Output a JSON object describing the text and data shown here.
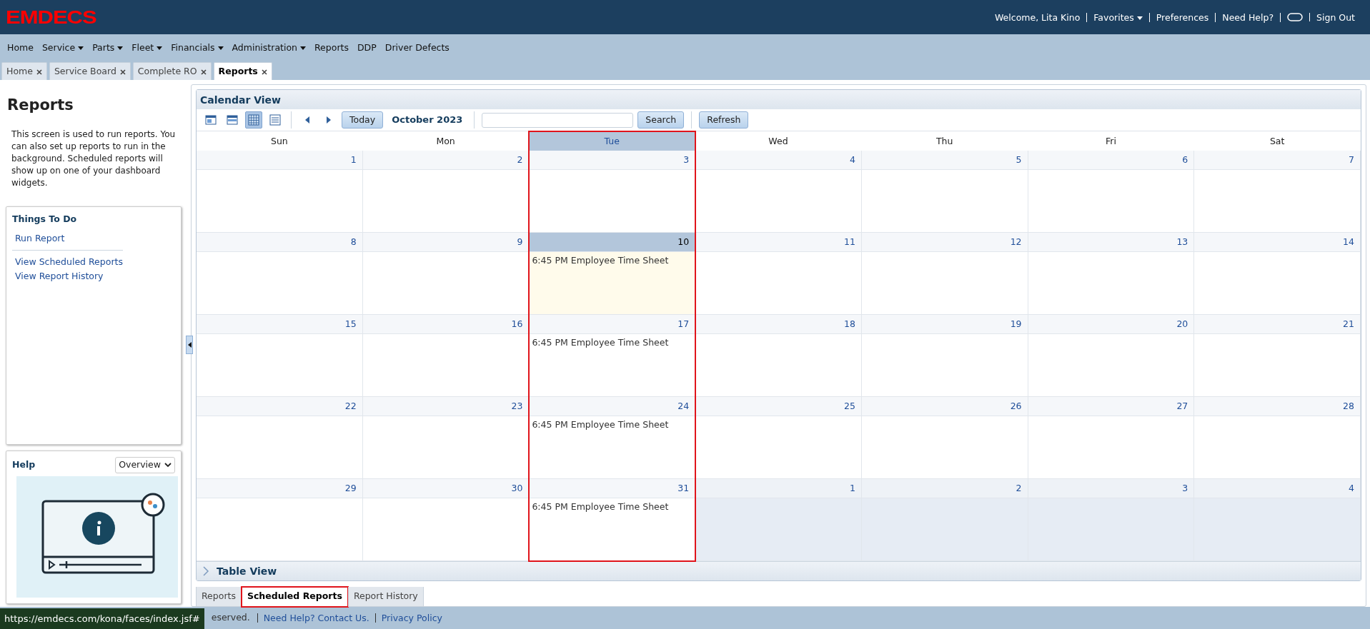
{
  "app": {
    "logo": "EMDECS"
  },
  "header": {
    "welcome": "Welcome, Lita Kino",
    "links": [
      {
        "kind": "dropdown",
        "label": "Favorites"
      },
      {
        "kind": "link",
        "label": "Preferences"
      },
      {
        "kind": "link",
        "label": "Need Help?"
      },
      {
        "kind": "chat"
      },
      {
        "kind": "link",
        "label": "Sign Out"
      }
    ]
  },
  "menu": [
    {
      "label": "Home",
      "dropdown": false
    },
    {
      "label": "Service",
      "dropdown": true
    },
    {
      "label": "Parts",
      "dropdown": true
    },
    {
      "label": "Fleet",
      "dropdown": true
    },
    {
      "label": "Financials",
      "dropdown": true
    },
    {
      "label": "Administration",
      "dropdown": true
    },
    {
      "label": "Reports",
      "dropdown": false
    },
    {
      "label": "DDP",
      "dropdown": false
    },
    {
      "label": "Driver Defects",
      "dropdown": false
    }
  ],
  "tabs": [
    {
      "label": "Home",
      "selected": false
    },
    {
      "label": "Service Board",
      "selected": false
    },
    {
      "label": "Complete RO",
      "selected": false
    },
    {
      "label": "Reports",
      "selected": true
    }
  ],
  "sidebar": {
    "title": "Reports",
    "description": "This screen is used to run reports. You can also set up reports to run in the background. Scheduled reports will show up on one of your dashboard widgets.",
    "todo": {
      "title": "Things To Do",
      "groups": [
        [
          "Run Report"
        ],
        [
          "View Scheduled Reports",
          "View Report History"
        ]
      ]
    },
    "help": {
      "title": "Help",
      "topic": "Overview",
      "kind": "picture"
    }
  },
  "calendar": {
    "title": "Calendar View",
    "views": [
      {
        "kind": "day",
        "selected": false
      },
      {
        "kind": "week",
        "selected": false
      },
      {
        "kind": "month",
        "selected": true
      },
      {
        "kind": "list",
        "selected": false
      }
    ],
    "today_button": "Today",
    "period": "October 2023",
    "search_button": "Search",
    "refresh_button": "Refresh",
    "weekdays": [
      {
        "label": "Sun",
        "selected": false,
        "highlighted": false
      },
      {
        "label": "Mon",
        "selected": false,
        "highlighted": false
      },
      {
        "label": "Tue",
        "selected": true,
        "highlighted": true
      },
      {
        "label": "Wed",
        "selected": false,
        "highlighted": false
      },
      {
        "label": "Thu",
        "selected": false,
        "highlighted": false
      },
      {
        "label": "Fri",
        "selected": false,
        "highlighted": false
      },
      {
        "label": "Sat",
        "selected": false,
        "highlighted": false
      }
    ],
    "weeks": [
      [
        {
          "date": "1",
          "in_month": true,
          "today": false
        },
        {
          "date": "2",
          "in_month": true,
          "today": false
        },
        {
          "date": "3",
          "in_month": true,
          "today": false
        },
        {
          "date": "4",
          "in_month": true,
          "today": false
        },
        {
          "date": "5",
          "in_month": true,
          "today": false
        },
        {
          "date": "6",
          "in_month": true,
          "today": false
        },
        {
          "date": "7",
          "in_month": true,
          "today": false
        }
      ],
      [
        {
          "date": "8",
          "in_month": true,
          "today": false
        },
        {
          "date": "9",
          "in_month": true,
          "today": false
        },
        {
          "date": "10",
          "in_month": true,
          "today": true,
          "events": [
            "6:45 PM Employee Time Sheet"
          ]
        },
        {
          "date": "11",
          "in_month": true,
          "today": false
        },
        {
          "date": "12",
          "in_month": true,
          "today": false
        },
        {
          "date": "13",
          "in_month": true,
          "today": false
        },
        {
          "date": "14",
          "in_month": true,
          "today": false
        }
      ],
      [
        {
          "date": "15",
          "in_month": true,
          "today": false
        },
        {
          "date": "16",
          "in_month": true,
          "today": false
        },
        {
          "date": "17",
          "in_month": true,
          "today": false,
          "events": [
            "6:45 PM Employee Time Sheet"
          ]
        },
        {
          "date": "18",
          "in_month": true,
          "today": false
        },
        {
          "date": "19",
          "in_month": true,
          "today": false
        },
        {
          "date": "20",
          "in_month": true,
          "today": false
        },
        {
          "date": "21",
          "in_month": true,
          "today": false
        }
      ],
      [
        {
          "date": "22",
          "in_month": true,
          "today": false
        },
        {
          "date": "23",
          "in_month": true,
          "today": false
        },
        {
          "date": "24",
          "in_month": true,
          "today": false,
          "events": [
            "6:45 PM Employee Time Sheet"
          ]
        },
        {
          "date": "25",
          "in_month": true,
          "today": false
        },
        {
          "date": "26",
          "in_month": true,
          "today": false
        },
        {
          "date": "27",
          "in_month": true,
          "today": false
        },
        {
          "date": "28",
          "in_month": true,
          "today": false
        }
      ],
      [
        {
          "date": "29",
          "in_month": true,
          "today": false
        },
        {
          "date": "30",
          "in_month": true,
          "today": false
        },
        {
          "date": "31",
          "in_month": true,
          "today": false,
          "events": [
            "6:45 PM Employee Time Sheet"
          ]
        },
        {
          "date": "1",
          "in_month": false,
          "today": false
        },
        {
          "date": "2",
          "in_month": false,
          "today": false
        },
        {
          "date": "3",
          "in_month": false,
          "today": false
        },
        {
          "date": "4",
          "in_month": false,
          "today": false
        }
      ]
    ]
  },
  "table_view": {
    "title": "Table View",
    "expanded": false
  },
  "bottom_tabs": [
    {
      "label": "Reports",
      "selected": false,
      "highlighted": false
    },
    {
      "label": "Scheduled Reports",
      "selected": true,
      "highlighted": true
    },
    {
      "label": "Report History",
      "selected": false,
      "highlighted": false
    }
  ],
  "footer": {
    "status_url": "https://emdecs.com/kona/faces/index.jsf#",
    "copyright": "eserved.",
    "links": [
      "Need Help? Contact Us.",
      "Privacy Policy"
    ]
  }
}
